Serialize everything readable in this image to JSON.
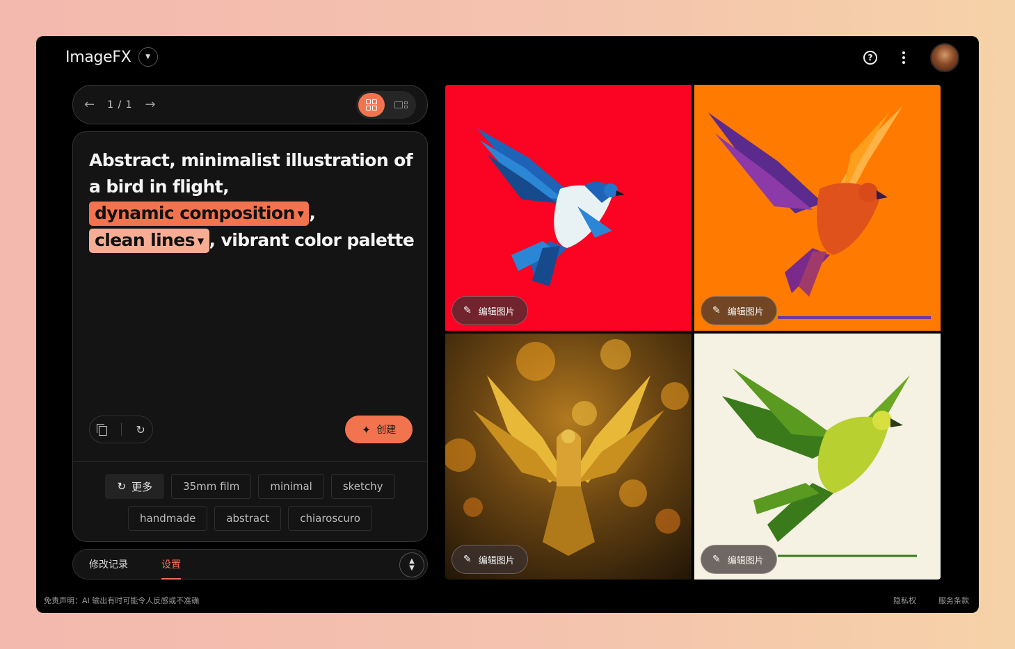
{
  "app": {
    "name": "ImageFX"
  },
  "pager": {
    "prev_icon": "arrow-left-icon",
    "count": "1 / 1",
    "next_icon": "arrow-right-icon"
  },
  "prompt": {
    "line_start": "Abstract, minimalist illustration of a bird in flight,",
    "chip1": "dynamic composition",
    "sep1": ",",
    "chip2": "clean lines",
    "line_end": ", vibrant color palette",
    "create_label": "创建"
  },
  "suggestions": {
    "more_label": "更多",
    "row1": [
      "35mm film",
      "minimal",
      "sketchy"
    ],
    "row2": [
      "handmade",
      "abstract",
      "chiaroscuro"
    ]
  },
  "tabs": {
    "history": "修改记录",
    "settings": "设置",
    "active": "settings"
  },
  "images": [
    {
      "edit_label": "编辑图片",
      "background": "#fb0322",
      "subject": "blue bird"
    },
    {
      "edit_label": "编辑图片",
      "background": "#ff7a00",
      "subject": "orange bird"
    },
    {
      "edit_label": "编辑图片",
      "background": "#6a4512",
      "subject": "golden bird with bokeh"
    },
    {
      "edit_label": "编辑图片",
      "background": "#f5f1e3",
      "subject": "green bird"
    }
  ],
  "footer": {
    "disclaimer": "免责声明：AI 输出有时可能令人反感或不准确",
    "privacy": "隐私权",
    "terms": "服务条款"
  },
  "colors": {
    "accent": "#f2744f",
    "accent_light": "#f7ad94"
  }
}
